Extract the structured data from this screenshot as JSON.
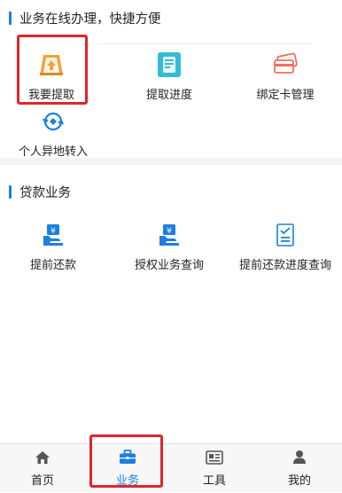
{
  "online_section": {
    "title": "业务在线办理，快捷方便",
    "items": [
      {
        "label": "我要提取",
        "icon": "withdraw-box-icon"
      },
      {
        "label": "提取进度",
        "icon": "progress-phone-icon"
      },
      {
        "label": "绑定卡管理",
        "icon": "bank-card-icon"
      },
      {
        "label": "个人异地转入",
        "icon": "transfer-in-icon"
      }
    ]
  },
  "loan_section": {
    "title": "贷款业务",
    "items": [
      {
        "label": "提前还款",
        "icon": "yuan-hand-icon"
      },
      {
        "label": "授权业务查询",
        "icon": "yuan-hand-icon"
      },
      {
        "label": "提前还款进度查询",
        "icon": "checklist-icon"
      }
    ]
  },
  "tabbar": {
    "tabs": [
      {
        "label": "首页",
        "icon": "home-icon"
      },
      {
        "label": "业务",
        "icon": "briefcase-icon"
      },
      {
        "label": "工具",
        "icon": "newspaper-icon"
      },
      {
        "label": "我的",
        "icon": "person-icon"
      }
    ],
    "active_index": 1
  },
  "colors": {
    "accent": "#1e7fe0",
    "highlight": "#e3242b",
    "orange": "#f0a23c",
    "teal": "#33bcd6",
    "coral": "#f26f5b"
  }
}
